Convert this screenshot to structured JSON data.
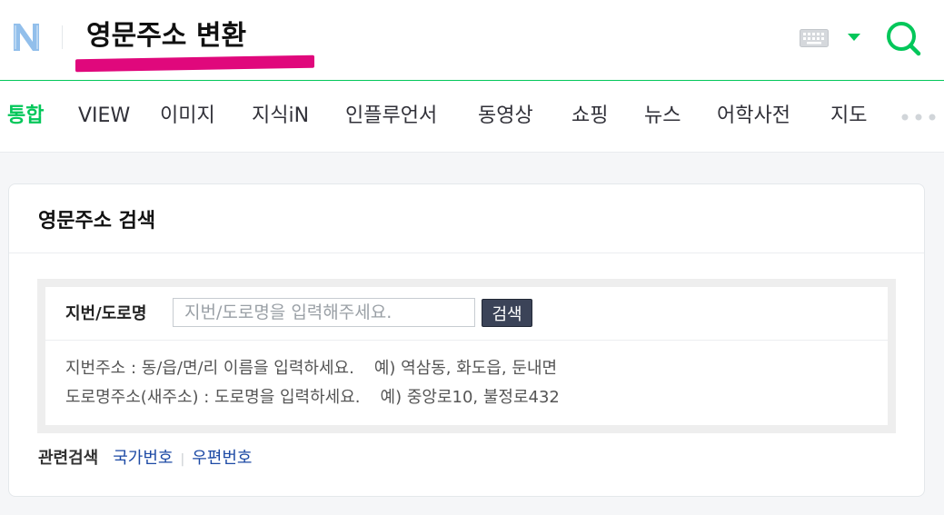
{
  "header": {
    "query": "영문주소 변환",
    "colors": {
      "brand": "#03c75a",
      "highlight": "#e0087c"
    }
  },
  "tabs": [
    {
      "label": "통합",
      "active": true
    },
    {
      "label": "VIEW"
    },
    {
      "label": "이미지"
    },
    {
      "label": "지식iN"
    },
    {
      "label": "인플루언서"
    },
    {
      "label": "동영상"
    },
    {
      "label": "쇼핑"
    },
    {
      "label": "뉴스"
    },
    {
      "label": "어학사전"
    },
    {
      "label": "지도"
    }
  ],
  "card": {
    "title": "영문주소 검색",
    "search": {
      "label": "지번/도로명",
      "placeholder": "지번/도로명을 입력해주세요.",
      "value": "",
      "button": "검색"
    },
    "help": [
      {
        "text": "지번주소 : 동/읍/면/리 이름을 입력하세요.",
        "example": "예) 역삼동, 화도읍, 둔내면"
      },
      {
        "text": "도로명주소(새주소) : 도로명을 입력하세요.",
        "example": "예) 중앙로10, 불정로432"
      }
    ],
    "related": {
      "label": "관련검색",
      "links": [
        "국가번호",
        "우편번호"
      ]
    }
  }
}
